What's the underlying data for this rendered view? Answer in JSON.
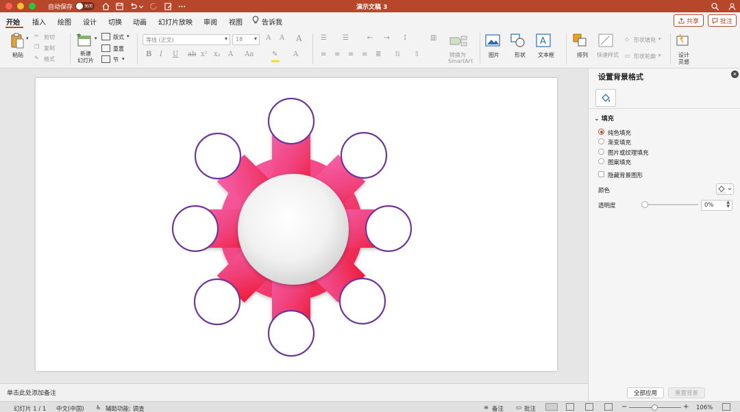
{
  "window": {
    "title": "演示文稿 3",
    "autosave_label": "自动保存",
    "autosave_state": "关闭"
  },
  "colors": {
    "accent": "#b7472a",
    "circle_stroke": "#6f3499",
    "shape_pink": "#f0508c",
    "shape_red": "#ee1e3c"
  },
  "tabs": [
    "开始",
    "插入",
    "绘图",
    "设计",
    "切换",
    "动画",
    "幻灯片放映",
    "审阅",
    "视图"
  ],
  "tell_me": "告诉我",
  "share_label": "共享",
  "comment_label": "批注",
  "ribbon": {
    "paste": "粘贴",
    "cut": "剪切",
    "copy": "复制",
    "format": "格式",
    "new_slide_1": "新建",
    "new_slide_2": "幻灯片",
    "layout": "版式",
    "reset": "重置",
    "section": "节",
    "font_name": "等线 (正文)",
    "font_size": "18",
    "convert_1": "转换为",
    "convert_2": "SmartArt",
    "picture": "图片",
    "shape": "形状",
    "textbox": "文本框",
    "arrange": "排列",
    "quick_styles": "快速样式",
    "shape_fill": "形状填充",
    "shape_outline": "形状轮廓",
    "design_1": "设计",
    "design_2": "灵感"
  },
  "notes_placeholder": "单击此处添加备注",
  "panel": {
    "title": "设置背景格式",
    "section_fill": "填充",
    "options": [
      "纯色填充",
      "渐变填充",
      "图片或纹理填充",
      "图案填充"
    ],
    "selected_option": "纯色填充",
    "hide_bg_graphics": "隐藏背景图形",
    "color_label": "颜色",
    "transparency_label": "透明度",
    "transparency_value": "0%",
    "apply_all": "全部应用",
    "reset_bg": "重置背景"
  },
  "status": {
    "slide_info": "幻灯片 1 / 1",
    "language": "中文(中国)",
    "accessibility": "辅助功能: 调查",
    "notes": "备注",
    "comments": "批注",
    "zoom": "106%"
  }
}
